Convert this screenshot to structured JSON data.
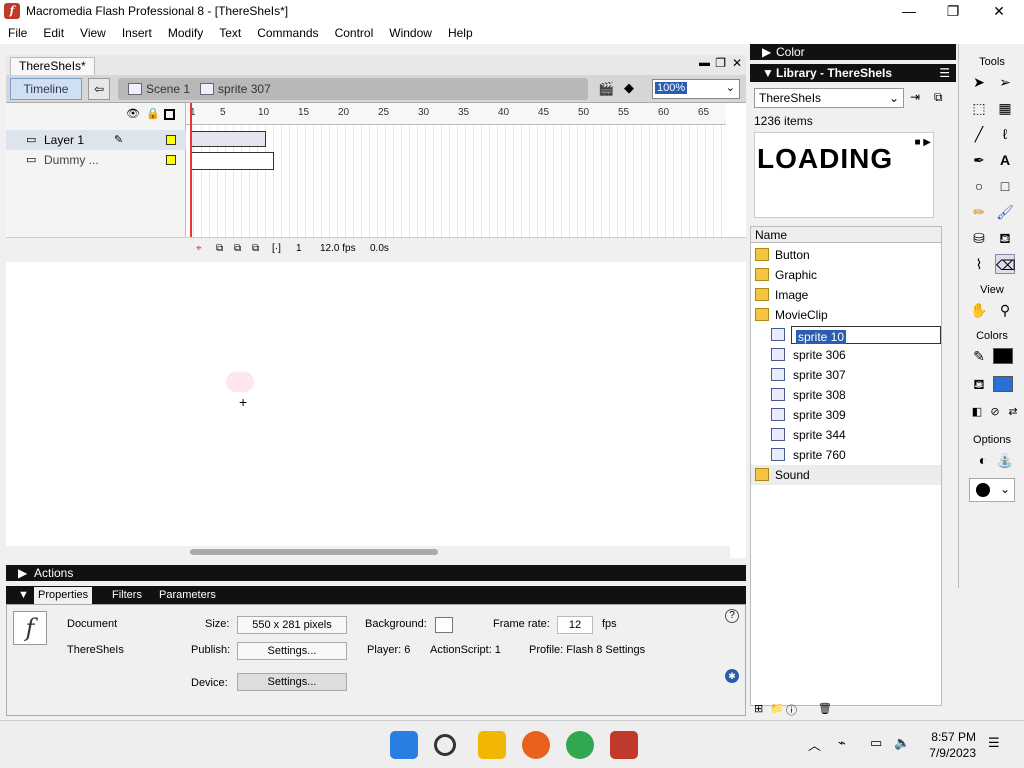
{
  "window": {
    "title": "Macromedia Flash Professional 8 - [ThereSheIs*]",
    "minimize": "—",
    "restore": "❐",
    "close": "✕"
  },
  "menu": [
    "File",
    "Edit",
    "View",
    "Insert",
    "Modify",
    "Text",
    "Commands",
    "Control",
    "Window",
    "Help"
  ],
  "doc_tab": "ThereSheIs*",
  "timeline_bar": {
    "timeline_btn": "Timeline",
    "scene": "Scene 1",
    "symbol": "sprite 307",
    "zoom": "100%"
  },
  "timeline": {
    "layers": [
      {
        "name": "Layer 1"
      },
      {
        "name": "Dummy ..."
      }
    ],
    "ruler": [
      "1",
      "5",
      "10",
      "15",
      "20",
      "25",
      "30",
      "35",
      "40",
      "45",
      "50",
      "55",
      "60",
      "65"
    ],
    "frame": "1",
    "fps": "12.0 fps",
    "time": "0.0s"
  },
  "panels": {
    "actions": "Actions",
    "color": "Color",
    "library": "Library - ThereSheIs"
  },
  "props": {
    "tabs": [
      "Properties",
      "Filters",
      "Parameters"
    ],
    "doc_label": "Document",
    "doc_name": "ThereSheIs",
    "size_label": "Size:",
    "size_value": "550 x 281 pixels",
    "bg_label": "Background:",
    "rate_label": "Frame rate:",
    "rate_value": "12",
    "fps": "fps",
    "publish_label": "Publish:",
    "settings_btn": "Settings...",
    "player": "Player: 6",
    "actionscript": "ActionScript: 1",
    "profile": "Profile: Flash 8 Settings",
    "device_label": "Device:",
    "device_btn": "Settings..."
  },
  "library": {
    "selected_doc": "ThereSheIs",
    "count": "1236 items",
    "preview_text": "LOADING",
    "col_name": "Name",
    "items": [
      {
        "name": "Button",
        "kind": "folder"
      },
      {
        "name": "Graphic",
        "kind": "folder"
      },
      {
        "name": "Image",
        "kind": "folder"
      },
      {
        "name": "MovieClip",
        "kind": "folder"
      },
      {
        "name": "sprite 10",
        "kind": "rename"
      },
      {
        "name": "sprite 306",
        "kind": "clip"
      },
      {
        "name": "sprite 307",
        "kind": "clip"
      },
      {
        "name": "sprite 308",
        "kind": "clip"
      },
      {
        "name": "sprite 309",
        "kind": "clip"
      },
      {
        "name": "sprite 344",
        "kind": "clip"
      },
      {
        "name": "sprite 760",
        "kind": "clip"
      },
      {
        "name": "Sound",
        "kind": "folder"
      }
    ]
  },
  "tools": {
    "title": "Tools",
    "view": "View",
    "colors": "Colors",
    "options": "Options"
  },
  "taskbar": {
    "time": "8:57 PM",
    "date": "7/9/2023"
  }
}
